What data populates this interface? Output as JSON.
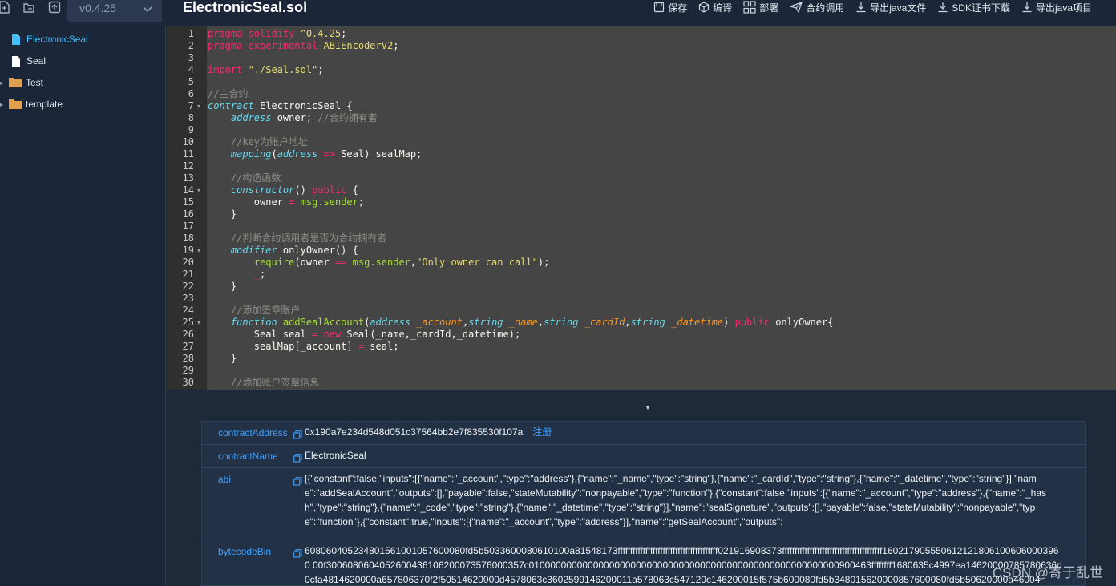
{
  "app": {
    "version": "v0.4.25",
    "file_title": "ElectronicSeal.sol"
  },
  "toolbar": {
    "actions": [
      {
        "label": "保存",
        "icon": "save-icon"
      },
      {
        "label": "编译",
        "icon": "cube-icon"
      },
      {
        "label": "部署",
        "icon": "grid-icon"
      },
      {
        "label": "合约调用",
        "icon": "send-icon"
      },
      {
        "label": "导出java文件",
        "icon": "download-icon"
      },
      {
        "label": "SDK证书下载",
        "icon": "download-icon"
      },
      {
        "label": "导出java项目",
        "icon": "download-icon"
      }
    ]
  },
  "sidebar": {
    "items": [
      {
        "label": "ElectronicSeal",
        "type": "file",
        "active": true
      },
      {
        "label": "Seal",
        "type": "file",
        "active": false
      },
      {
        "label": "Test",
        "type": "folder",
        "active": false
      },
      {
        "label": "template",
        "type": "folder",
        "active": false
      }
    ]
  },
  "editor": {
    "line_numbers": [
      "1",
      "2",
      "3",
      "4",
      "5",
      "6",
      "7",
      "8",
      "9",
      "10",
      "11",
      "12",
      "13",
      "14",
      "15",
      "16",
      "17",
      "18",
      "19",
      "20",
      "21",
      "22",
      "23",
      "24",
      "25",
      "26",
      "27",
      "28",
      "29",
      "30"
    ]
  },
  "results": {
    "contractAddress": {
      "key": "contractAddress",
      "value": "0x190a7e234d548d051c37564bb2e7f835530f107a",
      "link": "注册"
    },
    "contractName": {
      "key": "contractName",
      "value": "ElectronicSeal"
    },
    "abi": {
      "key": "abi",
      "value": "[{\"constant\":false,\"inputs\":[{\"name\":\"_account\",\"type\":\"address\"},{\"name\":\"_name\",\"type\":\"string\"},{\"name\":\"_cardId\",\"type\":\"string\"},{\"name\":\"_datetime\",\"type\":\"string\"}],\"name\":\"addSealAccount\",\"outputs\":[],\"payable\":false,\"stateMutability\":\"nonpayable\",\"type\":\"function\"},{\"constant\":false,\"inputs\":[{\"name\":\"_account\",\"type\":\"address\"},{\"name\":\"_hash\",\"type\":\"string\"},{\"name\":\"_code\",\"type\":\"string\"},{\"name\":\"_datetime\",\"type\":\"string\"}],\"name\":\"sealSignature\",\"outputs\":[],\"payable\":false,\"stateMutability\":\"nonpayable\",\"type\":\"function\"},{\"constant\":true,\"inputs\":[{\"name\":\"_account\",\"type\":\"address\"}],\"name\":\"getSealAccount\",\"outputs\":"
    },
    "bytecodeBin": {
      "key": "bytecodeBin",
      "value": "608060405234801561001057600080fd5b5033600080610100a81548173ffffffffffffffffffffffffffffffffffffffff021916908373ffffffffffffffffffffffffffffffffffffffff1602179055506121218061006060003960 00f3006080604052600436106200073576000357c0100000000000000000000000000000000000000000000000000000000900463ffffffff1680635c4997ea14620000785780636d0cfa4814620000a657806370f2f50514620000d4578063c3602599146200011a578063c547120c146200015f575b600080fd5b348015620000857600080fd5b50620000a46004"
    }
  },
  "watermark": "CSDN @寄于乱世"
}
